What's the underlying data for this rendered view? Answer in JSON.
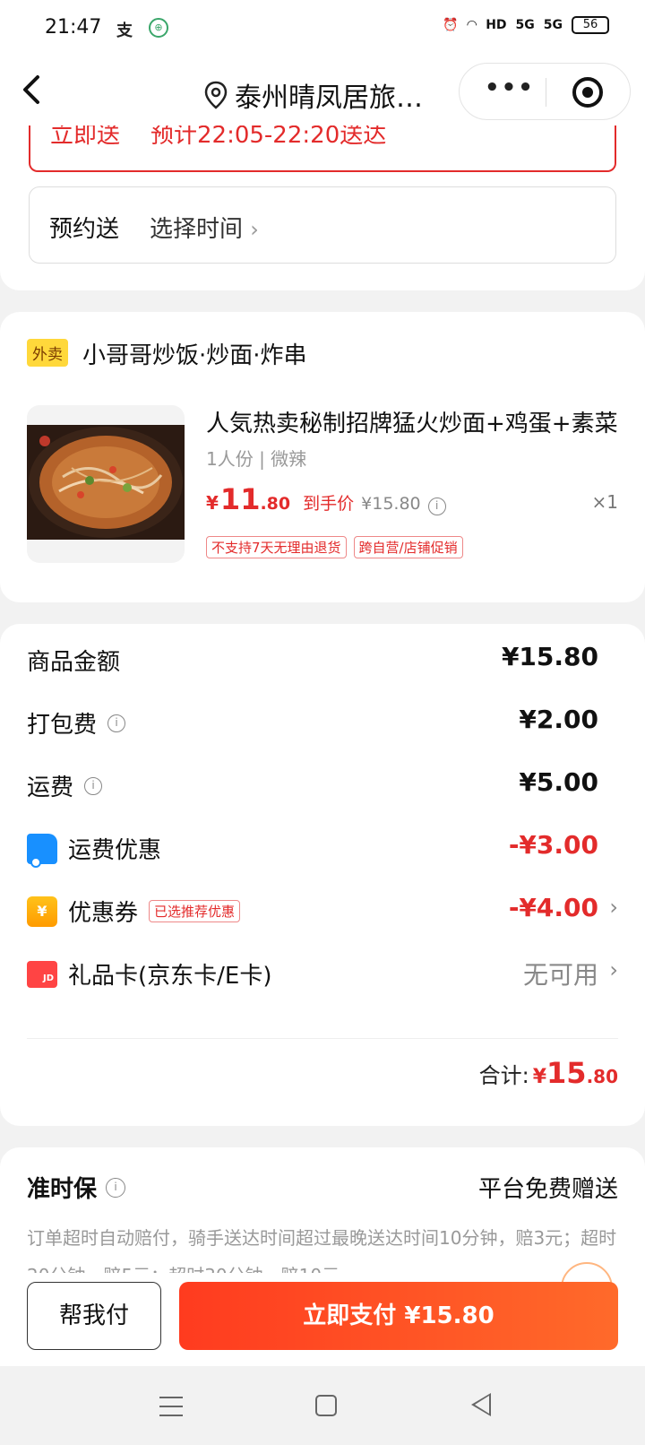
{
  "status_bar": {
    "time": "21:47",
    "app_icon_1": "支",
    "app_icon_2": "mini-app-icon",
    "signal_labels": [
      "HD",
      "5G",
      "5G"
    ],
    "battery": "56"
  },
  "nav": {
    "title": "泰州晴凤居旅…",
    "more_label": "•••"
  },
  "delivery": {
    "now_label": "立即送",
    "now_eta": "预计22:05-22:20送达",
    "schedule_label": "预约送",
    "schedule_value": "选择时间",
    "chevron": "›"
  },
  "product": {
    "tag": "外卖",
    "shop_name": "小哥哥炒饭·炒面·炸串",
    "title": "人気热卖秘制招牌猛火炒面+鸡蛋+素菜",
    "spec": "1人份 | 微辣",
    "price_currency": "¥",
    "price_int": "11",
    "price_dec": ".80",
    "final_price_label": "到手价",
    "original_price": "¥15.80",
    "info": "i",
    "qty": "×1",
    "tags": [
      "不支持7天无理由退货",
      "跨自营/店铺促销"
    ]
  },
  "fees": {
    "goods_label": "商品金额",
    "goods_amount": "¥15.80",
    "packing_label": "打包费",
    "packing_amount": "¥2.00",
    "delivery_label": "运费",
    "delivery_amount": "¥5.00",
    "delivery_discount_label": "运费优惠",
    "delivery_discount_amount": "-¥3.00",
    "coupon_label": "优惠券",
    "coupon_tag": "已选推荐优惠",
    "coupon_amount": "-¥4.00",
    "coupon_icon": "¥",
    "giftcard_label": "礼品卡(京东卡/E卡)",
    "giftcard_icon": "JD",
    "giftcard_value": "无可用",
    "arrow": "›",
    "info": "i",
    "total_label": "合计:",
    "total_currency": "¥",
    "total_int": "15",
    "total_dec": ".80"
  },
  "ontime": {
    "title": "准时保",
    "info": "i",
    "gift": "平台免费赠送",
    "desc": "订单超时自动赔付，骑手送达时间超过最晚送达时间10分钟，赔3元；超时20分钟，赔5元；超时30分钟，赔10元。"
  },
  "paybar": {
    "help_label": "帮我付",
    "pay_label": "立即支付 ¥15.80"
  },
  "colors": {
    "accent_red": "#e32b2b",
    "pay_gradient_start": "#ff3b1f",
    "pay_gradient_end": "#ff6a2a",
    "tag_yellow": "#ffd83b",
    "truck_blue": "#1890ff"
  }
}
